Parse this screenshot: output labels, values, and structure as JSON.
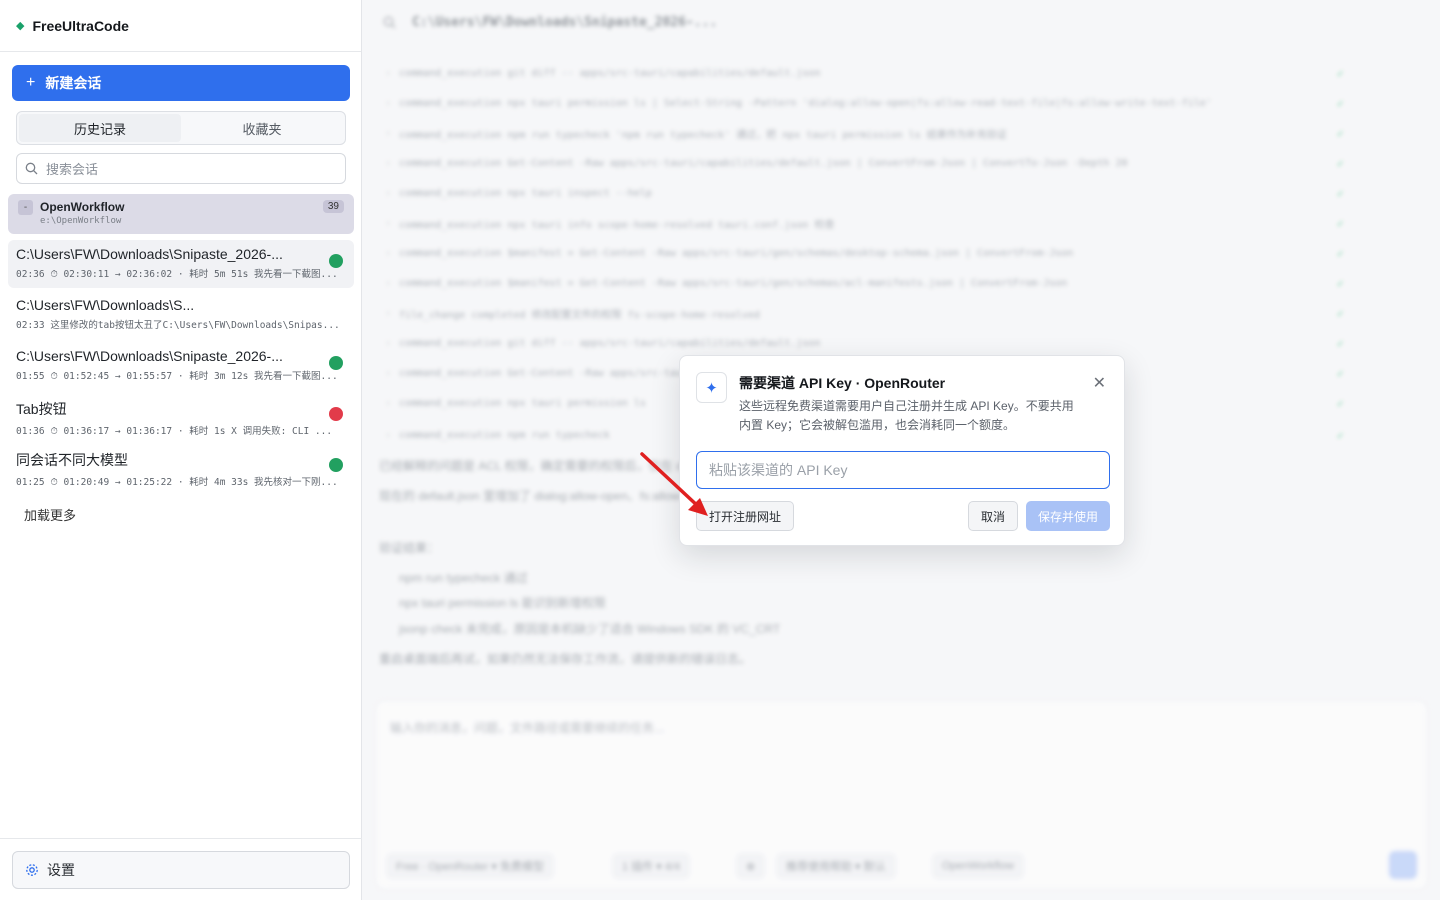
{
  "app": {
    "name": "FreeUltraCode"
  },
  "sidebar": {
    "new_chat_label": "新建会话",
    "tabs": [
      {
        "label": "历史记录"
      },
      {
        "label": "收藏夹"
      }
    ],
    "search_placeholder": "搜索会话",
    "group": {
      "name": "OpenWorkflow",
      "path": "e:\\OpenWorkflow",
      "count": "39",
      "toggle": "-"
    },
    "sessions": [
      {
        "title": "C:\\Users\\FW\\Downloads\\Snipaste_2026-...",
        "meta": "02:36 ⏱ 02:30:11 → 02:36:02 · 耗时 5m 51s 我先看一下截图...",
        "status_color": "#22a060"
      },
      {
        "title": "C:\\Users\\FW\\Downloads\\S...",
        "meta": "02:33 这里修改的tab按钮太丑了C:\\Users\\FW\\Downloads\\Snipas...",
        "status_color": ""
      },
      {
        "title": "C:\\Users\\FW\\Downloads\\Snipaste_2026-...",
        "meta": "01:55 ⏱ 01:52:45 → 01:55:57 · 耗时 3m 12s 我先看一下截图...",
        "status_color": "#22a060"
      },
      {
        "title": "Tab按钮",
        "meta": "01:36 ⏱ 01:36:17 → 01:36:17 · 耗时 1s X 调用失败: CLI ...",
        "status_color": "#e23b4a"
      },
      {
        "title": "同会话不同大模型",
        "meta": "01:25 ⏱ 01:20:49 → 01:25:22 · 耗时 4m 33s 我先核对一下刚...",
        "status_color": "#22a060"
      }
    ],
    "load_more": "加载更多",
    "settings_label": "设置"
  },
  "main": {
    "header_title": "C:\\Users\\FW\\Downloads\\Snipaste_2026-...",
    "log_lines": [
      "command_execution  git diff -- apps/src-tauri/capabilities/default.json",
      "command_execution  npx tauri permission ls | Select-String -Pattern 'dialog:allow-open|fs:allow-read-text-file|fs:allow-write-text-file'",
      "command_execution  npm run typecheck  'npm run typecheck' 通过，把 npx tauri permission ls 结果作为补充验证",
      "command_execution  Get-Content -Raw apps/src-tauri/capabilities/default.json | ConvertFrom-Json | ConvertTo-Json -Depth 20",
      "command_execution  npx tauri inspect --help",
      "command_execution  npx tauri info  scope-home-resolved  tauri.conf.json 检查",
      "command_execution  $manifest = Get-Content -Raw apps/src-tauri/gen/schemas/desktop-schema.json | ConvertFrom-Json",
      "command_execution  $manifest = Get-Content -Raw apps/src-tauri/gen/schemas/acl-manifests.json | ConvertFrom-Json",
      "file_change  completed  修改配置文件的权限  fs-scope-home-resolved",
      "command_execution  git diff -- apps/src-tauri/capabilities/default.json",
      "command_execution  Get-Content -Raw apps/src-tauri/capabilities/default.json",
      "command_execution  npx tauri permission ls",
      "command_execution  npm run typecheck"
    ],
    "paragraphs": [
      "已经解释的问题是 ACL 权限，确定需要的权限后，仅在 default.json 中添加最小必要权限，不需要重启开发服务器。",
      "现在的 default.json 里增加了 dialog:allow-open、fs:allow-read-text-file、fs:allow-write-text-file 和用户目录 scope。",
      "验证结果：",
      "npm run typecheck 通过",
      "npx tauri permission ls 能识别新增权限",
      "jsonp check 未完成，原因是本机缺少了适合 Windows SDK 的 VC_CRT",
      "重启桌面端后再试，如果仍然无法保存工作流，请提供新的错误日志。"
    ],
    "composer_placeholder": "输入你的消息，问题，文件路径或需要继续的任务...",
    "chips": [
      "Free · OpenRouter ▾ 免费模型",
      "1 插件 ▾ 4/4",
      "⊕",
      "推荐使用帮助 ▾ 默认",
      "OpenWorkflow"
    ]
  },
  "dialog": {
    "icon": "sparkle-icon",
    "title": "需要渠道 API Key · OpenRouter",
    "description": "这些远程免费渠道需要用户自己注册并生成 API Key。不要共用内置 Key；它会被解包滥用，也会消耗同一个额度。",
    "input_placeholder": "粘贴该渠道的 API Key",
    "register_label": "打开注册网址",
    "cancel_label": "取消",
    "save_label": "保存并使用",
    "accent_color": "#2f6fed"
  }
}
